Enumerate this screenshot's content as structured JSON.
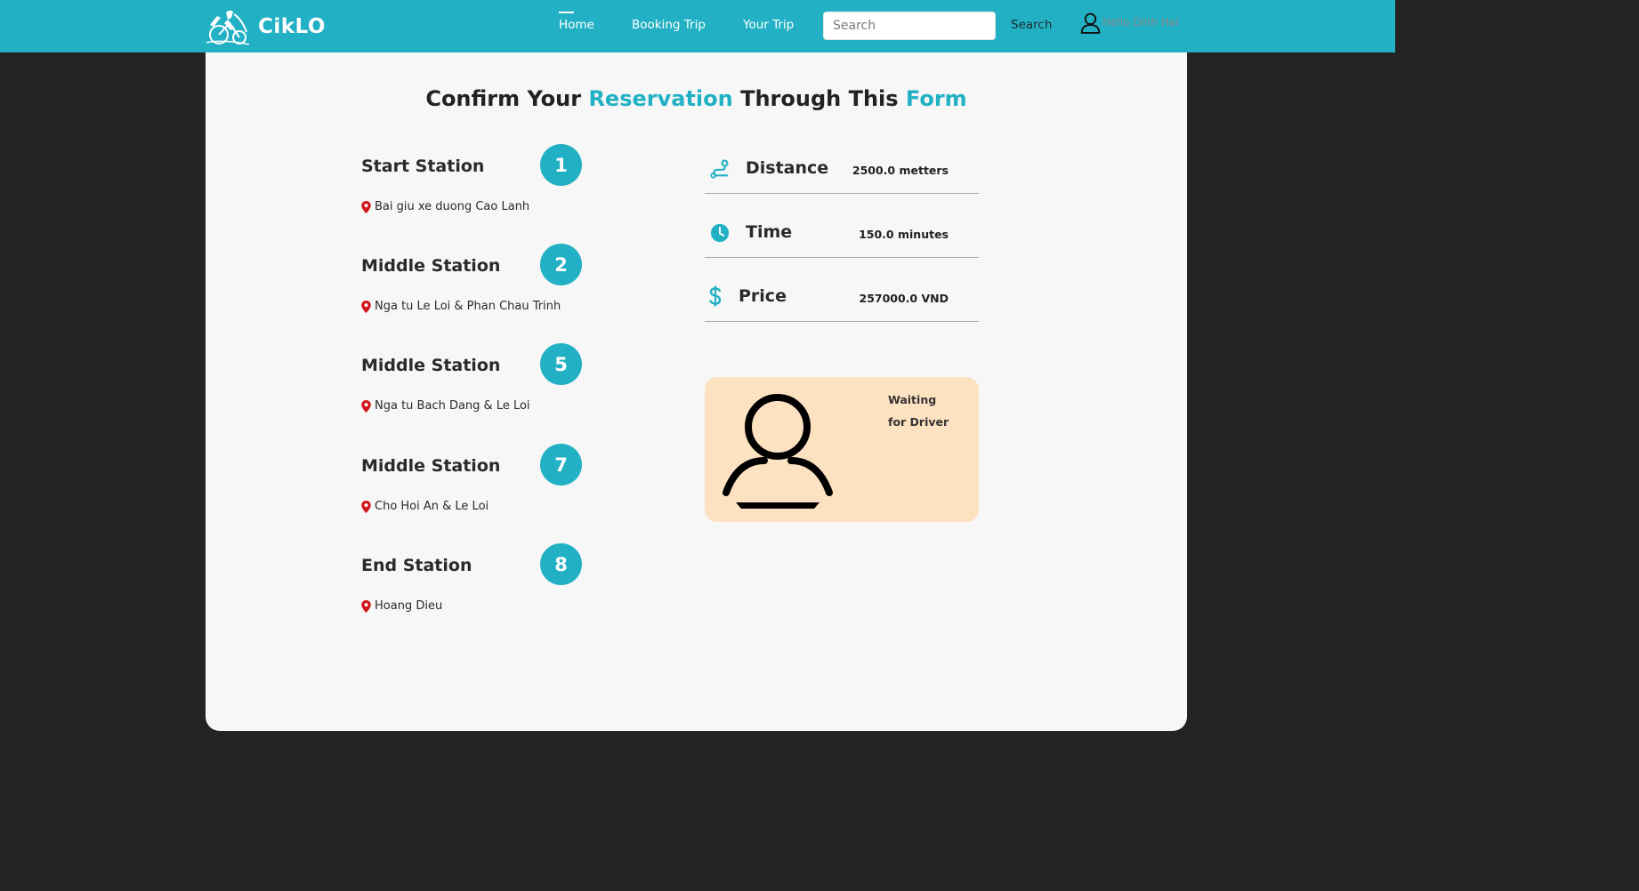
{
  "header": {
    "brand": "CikLO",
    "nav": {
      "home": "Home",
      "booking": "Booking Trip",
      "your_trip": "Your Trip"
    },
    "search": {
      "placeholder": "Search",
      "value": "",
      "button": "Search"
    },
    "user_greeting": "Hello Dinh Hai"
  },
  "form": {
    "title_parts": [
      "Confirm Your ",
      "Reservation",
      " Through This ",
      "Form"
    ],
    "stations": [
      {
        "label": "Start Station",
        "number": "1",
        "address": "Bai giu xe duong Cao Lanh"
      },
      {
        "label": "Middle Station",
        "number": "2",
        "address": "Nga tu Le Loi & Phan Chau Trinh"
      },
      {
        "label": "Middle Station",
        "number": "5",
        "address": "Nga tu Bach Dang & Le Loi"
      },
      {
        "label": "Middle Station",
        "number": "7",
        "address": "Cho Hoi An & Le Loi"
      },
      {
        "label": "End Station",
        "number": "8",
        "address": "Hoang Dieu"
      }
    ],
    "info": {
      "distance": {
        "label": "Distance",
        "value": "2500.0 metters"
      },
      "time": {
        "label": "Time",
        "value": "150.0 minutes"
      },
      "price": {
        "label": "Price",
        "value": "257000.0 VND"
      }
    },
    "driver_status": [
      "Waiting",
      "for Driver"
    ]
  },
  "colors": {
    "accent": "#22b1c4",
    "background": "#232323",
    "card": "#f7f7f7",
    "driver_box": "#fde2c1",
    "pin": "#d0161b"
  },
  "icons": [
    "logo-icon",
    "user-icon",
    "location-pin-icon",
    "route-icon",
    "clock-icon",
    "dollar-icon",
    "driver-avatar-icon"
  ]
}
